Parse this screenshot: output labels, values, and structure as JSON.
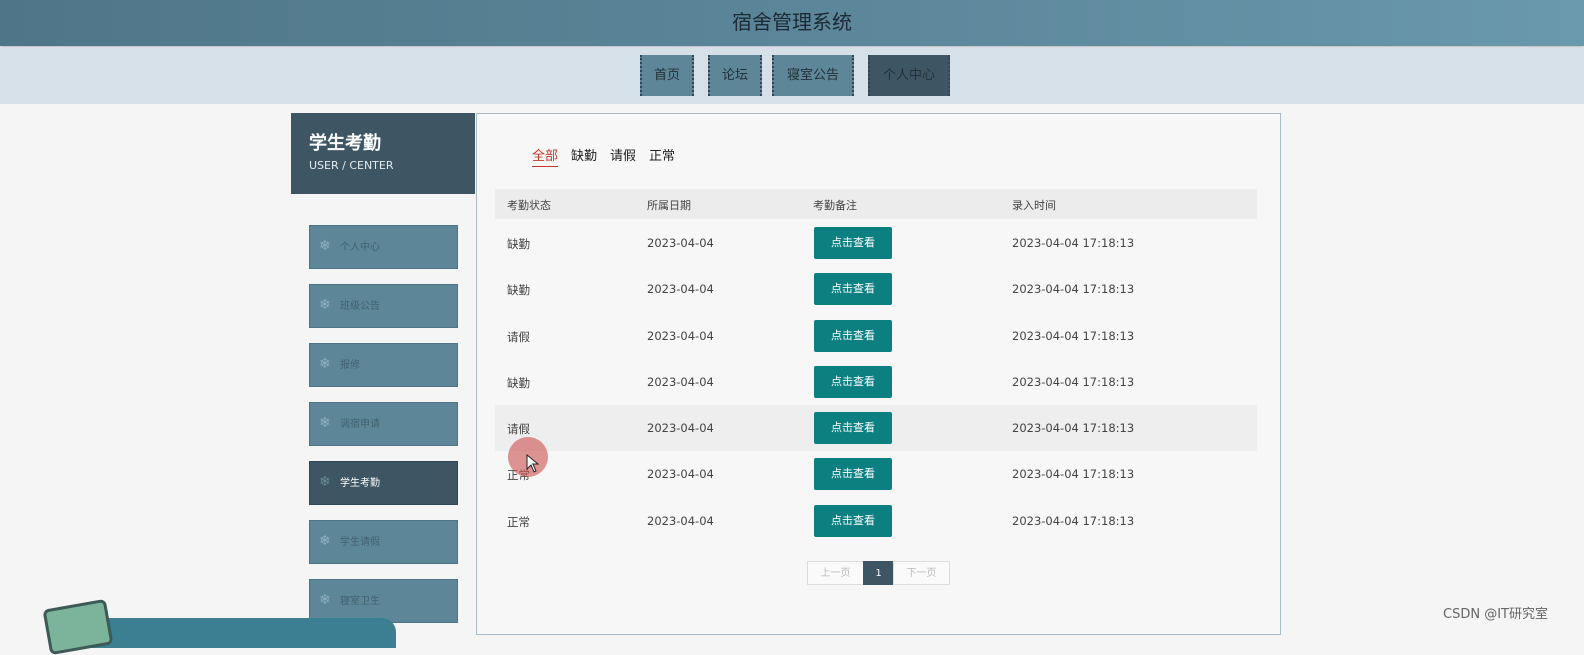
{
  "header": {
    "title": "宿舍管理系统"
  },
  "nav": {
    "items": [
      {
        "label": "首页"
      },
      {
        "label": "论坛"
      },
      {
        "label": "寝室公告"
      },
      {
        "label": "个人中心",
        "active": true
      }
    ]
  },
  "sidebar": {
    "title": "学生考勤",
    "subtitle": "USER / CENTER",
    "icon": "snowflake-icon",
    "items": [
      {
        "label": "个人中心"
      },
      {
        "label": "班级公告"
      },
      {
        "label": "报修"
      },
      {
        "label": "调宿申请"
      },
      {
        "label": "学生考勤",
        "active": true
      },
      {
        "label": "学生请假"
      },
      {
        "label": "寝室卫生"
      }
    ]
  },
  "filters": {
    "items": [
      {
        "label": "全部",
        "active": true
      },
      {
        "label": "缺勤"
      },
      {
        "label": "请假"
      },
      {
        "label": "正常"
      }
    ]
  },
  "table": {
    "headers": [
      "考勤状态",
      "所属日期",
      "考勤备注",
      "录入时间"
    ],
    "button_label": "点击查看",
    "rows": [
      {
        "status": "缺勤",
        "date": "2023-04-04",
        "time": "2023-04-04 17:18:13"
      },
      {
        "status": "缺勤",
        "date": "2023-04-04",
        "time": "2023-04-04 17:18:13"
      },
      {
        "status": "请假",
        "date": "2023-04-04",
        "time": "2023-04-04 17:18:13"
      },
      {
        "status": "缺勤",
        "date": "2023-04-04",
        "time": "2023-04-04 17:18:13"
      },
      {
        "status": "请假",
        "date": "2023-04-04",
        "time": "2023-04-04 17:18:13"
      },
      {
        "status": "正常",
        "date": "2023-04-04",
        "time": "2023-04-04 17:18:13"
      },
      {
        "status": "正常",
        "date": "2023-04-04",
        "time": "2023-04-04 17:18:13"
      }
    ]
  },
  "pagination": {
    "prev": "上一页",
    "current": "1",
    "next": "下一页"
  },
  "watermark": "CSDN @IT研究室",
  "colors": {
    "header": "#5b8599",
    "nav_item": "#5d8799",
    "nav_active": "#3e5663",
    "button": "#0c7f80",
    "filter_active": "#c0392b"
  }
}
